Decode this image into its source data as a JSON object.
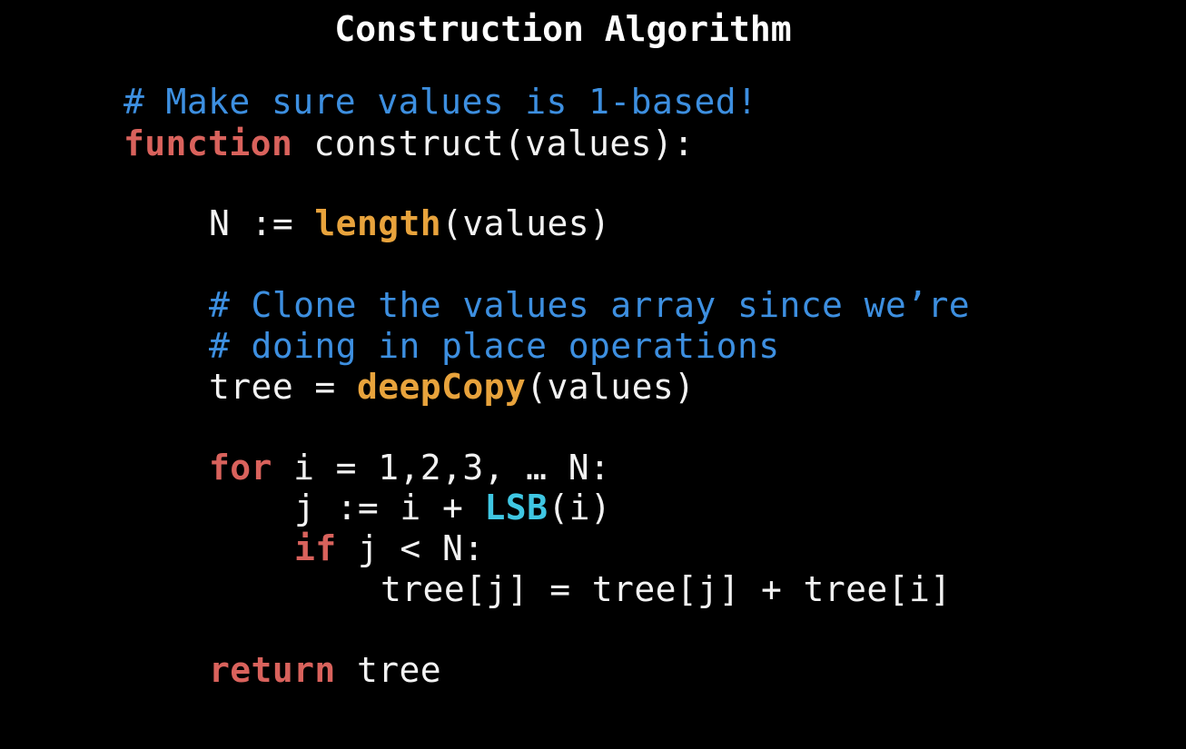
{
  "slide": {
    "title": "Construction Algorithm"
  },
  "colors": {
    "background": "#000000",
    "comment": "#3d8fe0",
    "keyword": "#d9625c",
    "builtin": "#e8a33c",
    "special": "#3fc7e3",
    "plain": "#f2f2f2"
  },
  "code": {
    "lines": [
      {
        "indent": 0,
        "tokens": [
          {
            "t": "# Make sure values is 1-based!",
            "k": "comment"
          }
        ]
      },
      {
        "indent": 0,
        "tokens": [
          {
            "t": "function",
            "k": "keyword"
          },
          {
            "t": " construct(values):",
            "k": "plain"
          }
        ]
      },
      {
        "indent": 0,
        "tokens": []
      },
      {
        "indent": 1,
        "tokens": [
          {
            "t": "N := ",
            "k": "plain"
          },
          {
            "t": "length",
            "k": "builtin"
          },
          {
            "t": "(values)",
            "k": "plain"
          }
        ]
      },
      {
        "indent": 0,
        "tokens": []
      },
      {
        "indent": 1,
        "tokens": [
          {
            "t": "# Clone the values array since we’re",
            "k": "comment"
          }
        ]
      },
      {
        "indent": 1,
        "tokens": [
          {
            "t": "# doing in place operations",
            "k": "comment"
          }
        ]
      },
      {
        "indent": 1,
        "tokens": [
          {
            "t": "tree = ",
            "k": "plain"
          },
          {
            "t": "deepCopy",
            "k": "builtin"
          },
          {
            "t": "(values)",
            "k": "plain"
          }
        ]
      },
      {
        "indent": 0,
        "tokens": []
      },
      {
        "indent": 1,
        "tokens": [
          {
            "t": "for",
            "k": "keyword"
          },
          {
            "t": " i = 1,2,3, … N:",
            "k": "plain"
          }
        ]
      },
      {
        "indent": 2,
        "tokens": [
          {
            "t": "j := i + ",
            "k": "plain"
          },
          {
            "t": "LSB",
            "k": "special"
          },
          {
            "t": "(i)",
            "k": "plain"
          }
        ]
      },
      {
        "indent": 2,
        "tokens": [
          {
            "t": "if",
            "k": "keyword"
          },
          {
            "t": " j < N:",
            "k": "plain"
          }
        ]
      },
      {
        "indent": 3,
        "tokens": [
          {
            "t": "tree[j] = tree[j] + tree[i]",
            "k": "plain"
          }
        ]
      },
      {
        "indent": 0,
        "tokens": []
      },
      {
        "indent": 1,
        "tokens": [
          {
            "t": "return",
            "k": "keyword"
          },
          {
            "t": " tree",
            "k": "plain"
          }
        ]
      }
    ]
  }
}
